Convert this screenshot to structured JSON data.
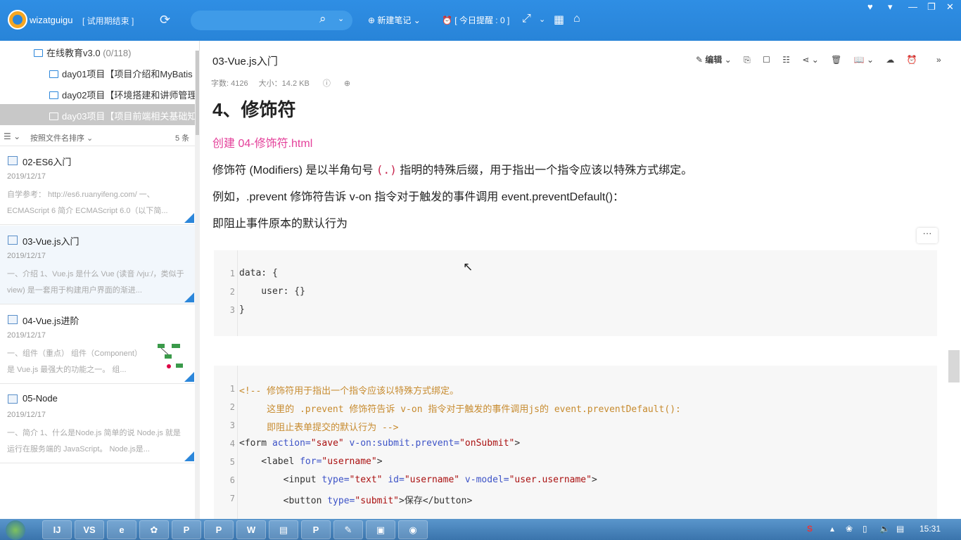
{
  "app": {
    "username": "wizatguigu",
    "trial_label": "[ 试用期结束 ]",
    "new_note": "⊕ 新建笔记 ⌄",
    "reminder": "⏰ [ 今日提醒 : 0 ]",
    "search_placeholder": ""
  },
  "sidebar": {
    "tree": [
      {
        "label": "在线教育v3.0",
        "count": "(0/118)"
      },
      {
        "label": "day01项目【项目介绍和MyBatis"
      },
      {
        "label": "day02项目【环境搭建和讲师管理"
      },
      {
        "label": "day03项目【项目前端相关基础知"
      }
    ],
    "sort_label": "按照文件名排序",
    "count_label": "5 条",
    "notes": [
      {
        "title": "02-ES6入门",
        "date": "2019/12/17",
        "snippet": "自学参考：  http://es6.ruanyifeng.com/  一、ECMAScript 6 简介 ECMAScript 6.0（以下简..."
      },
      {
        "title": "03-Vue.js入门",
        "date": "2019/12/17",
        "snippet": "一、介绍 1、Vue.js 是什么 Vue (读音 /vjuː/，类似于 view) 是一套用于构建用户界面的渐进..."
      },
      {
        "title": "04-Vue.js进阶",
        "date": "2019/12/17",
        "snippet": "一、组件（重点） 组件（Component）是 Vue.js 最强大的功能之一。 组..."
      },
      {
        "title": "05-Node",
        "date": "2019/12/17",
        "snippet": "一、简介 1、什么是Node.js 简单的说 Node.js 就是运行在服务端的 JavaScript。 Node.js是..."
      }
    ]
  },
  "note": {
    "title": "03-Vue.js入门",
    "meta_words": "字数: 4126",
    "meta_size": "大小：14.2 KB",
    "edit_label": "编辑",
    "heading": "4、修饰符",
    "create_line": "创建 04-修饰符.html",
    "para1_a": "修饰符 (Modifiers) 是以半角句号",
    "para1_code": "(.)",
    "para1_b": "指明的特殊后缀，用于指出一个指令应该以特殊方式绑定。",
    "para2": "例如，.prevent 修饰符告诉 v-on 指令对于触发的事件调用 event.preventDefault()：",
    "para3": "即阻止事件原本的默认行为",
    "more_label": "···"
  },
  "code1": {
    "lines": [
      "data: {",
      "    user: {}",
      "}"
    ],
    "numbers": [
      "1",
      "2",
      "3"
    ]
  },
  "code2": {
    "numbers": [
      "1",
      "2",
      "3",
      "4",
      "5",
      "6",
      "7"
    ],
    "l1": "<!-- 修饰符用于指出一个指令应该以特殊方式绑定。",
    "l2": "     这里的 .prevent 修饰符告诉 v-on 指令对于触发的事件调用js的 event.preventDefault():",
    "l3": "     即阻止表单提交的默认行为 -->",
    "l4_tag": "<form ",
    "l4_a1": "action=",
    "l4_v1": "\"save\"",
    "l4_a2": " v-on:submit.prevent=",
    "l4_v2": "\"onSubmit\"",
    "l4_end": ">",
    "l5_tag": "    <label ",
    "l5_a1": "for=",
    "l5_v1": "\"username\"",
    "l5_end": ">",
    "l6_tag": "        <input ",
    "l6_a1": "type=",
    "l6_v1": "\"text\"",
    "l6_a2": " id=",
    "l6_v2": "\"username\"",
    "l6_a3": " v-model=",
    "l6_v3": "\"user.username\"",
    "l6_end": ">",
    "l7_tag": "        <button ",
    "l7_a1": "type=",
    "l7_v1": "\"submit\"",
    "l7_end": ">保存</button>"
  },
  "taskbar": {
    "clock": "15:31",
    "buttons": [
      "IJ",
      "VS",
      "e",
      "✿",
      "P",
      "P",
      "W",
      "▤",
      "P",
      "✎",
      "▣",
      "◉"
    ]
  },
  "colors": {
    "topbar": "#2b86da",
    "accent_pink": "#e4409a"
  }
}
